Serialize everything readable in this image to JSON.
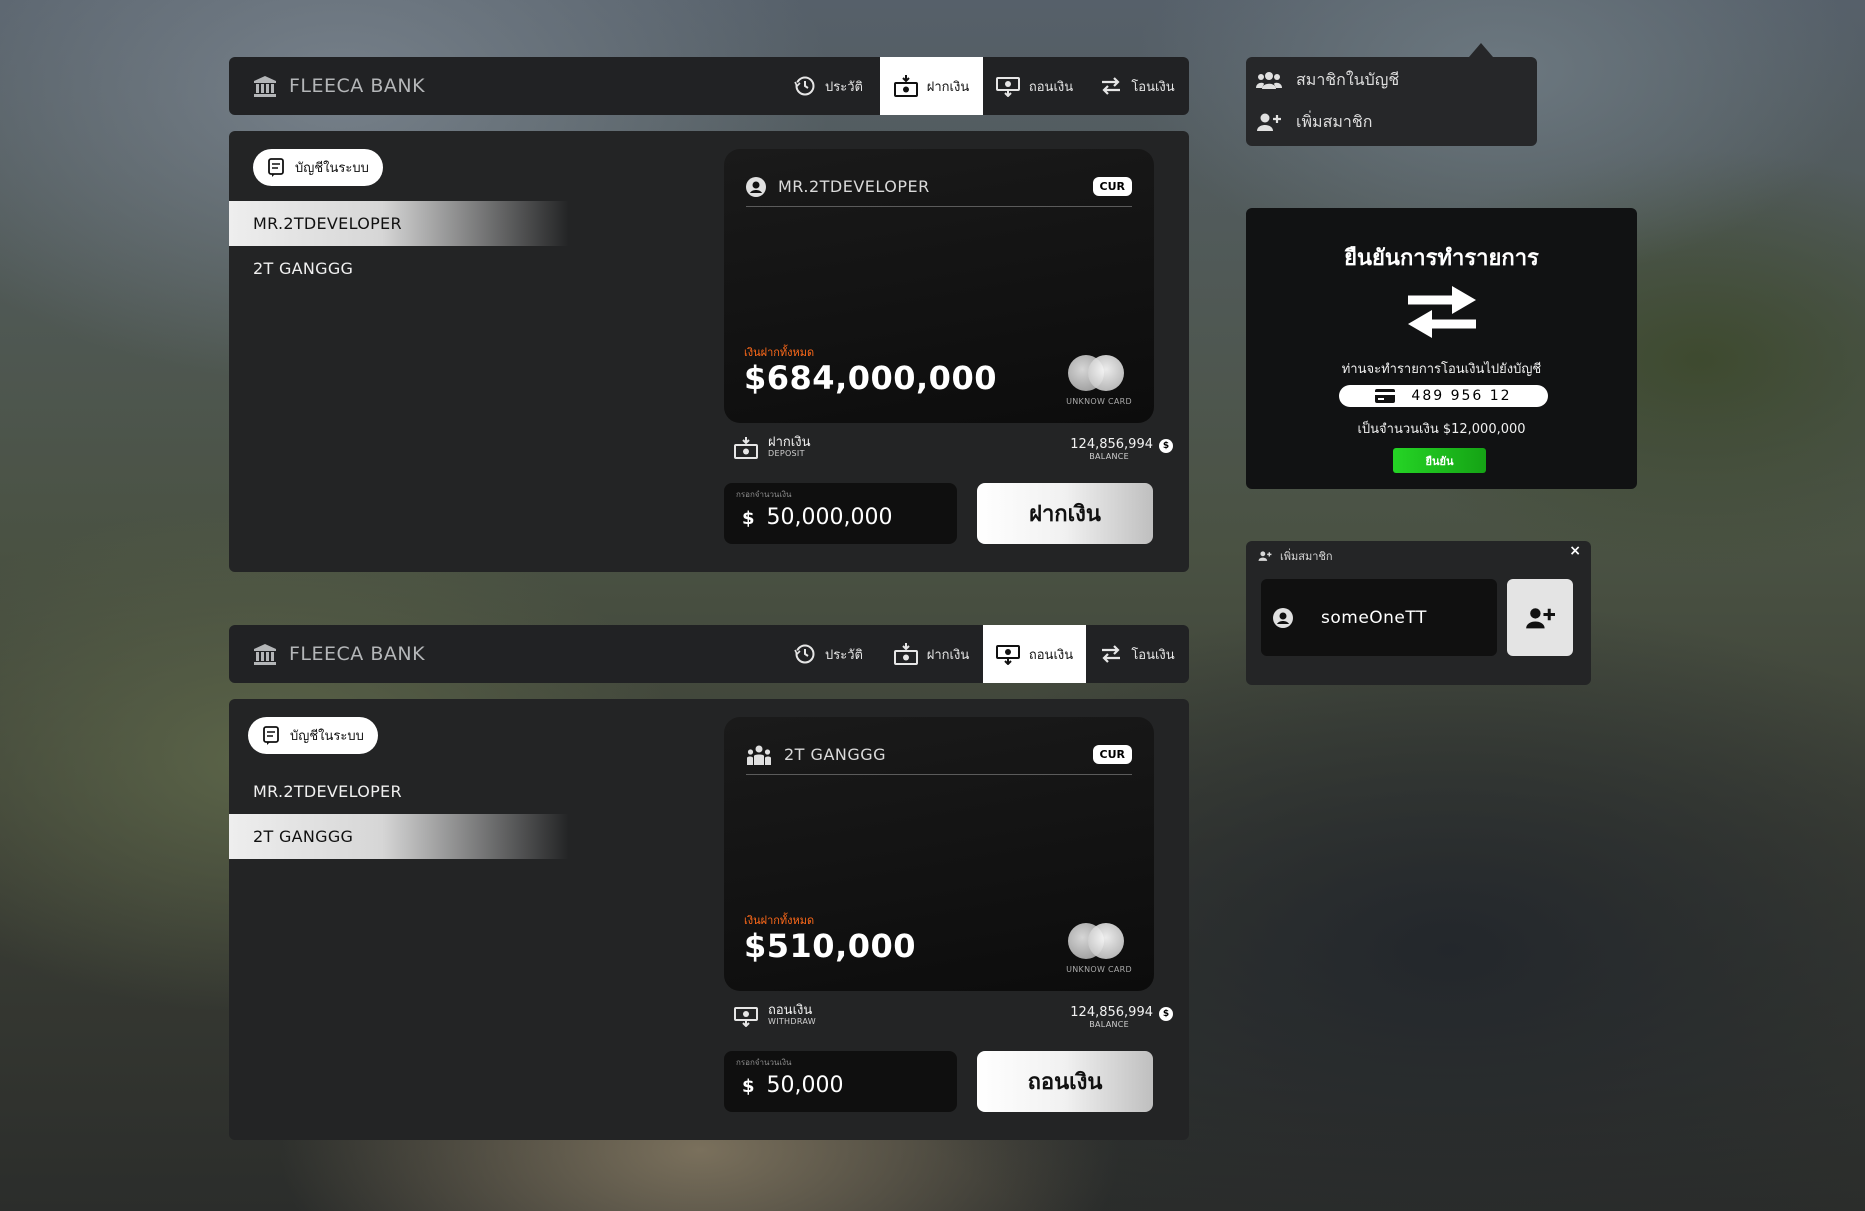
{
  "colors": {
    "panel_bg": "#232425",
    "nav_bg": "#212224",
    "accent_orange": "#ff6a1a",
    "confirm_green": "#1ecb1e"
  },
  "window1": {
    "brand": "FLEECA BANK",
    "tabs": [
      {
        "label": "ประวัติ",
        "icon": "history-icon"
      },
      {
        "label": "ฝากเงิน",
        "icon": "deposit-icon",
        "active": true
      },
      {
        "label": "ถอนเงิน",
        "icon": "withdraw-icon"
      },
      {
        "label": "โอนเงิน",
        "icon": "transfer-icon"
      }
    ],
    "accounts_button": "บัญชีในระบบ",
    "accounts": [
      "MR.2TDEVELOPER",
      "2T GANGGG"
    ],
    "selected_account": "MR.2TDEVELOPER",
    "card": {
      "owner": "MR.2TDEVELOPER",
      "currency": "CUR",
      "total_label": "เงินฝากทั้งหมด",
      "total": "$684,000,000",
      "card_type": "UNKNOW CARD"
    },
    "operation": {
      "title": "ฝากเงิน",
      "subtitle": "DEPOSIT"
    },
    "balance": {
      "value": "124,856,994",
      "label": "BALANCE",
      "symbol": "$"
    },
    "amount": {
      "placeholder": "กรอกจำนวนเงิน",
      "currency": "$",
      "value": "50,000,000"
    },
    "action_label": "ฝากเงิน"
  },
  "window2": {
    "brand": "FLEECA BANK",
    "tabs": [
      {
        "label": "ประวัติ",
        "icon": "history-icon"
      },
      {
        "label": "ฝากเงิน",
        "icon": "deposit-icon"
      },
      {
        "label": "ถอนเงิน",
        "icon": "withdraw-icon",
        "active": true
      },
      {
        "label": "โอนเงิน",
        "icon": "transfer-icon"
      }
    ],
    "accounts_button": "บัญชีในระบบ",
    "accounts": [
      "MR.2TDEVELOPER",
      "2T GANGGG"
    ],
    "selected_account": "2T GANGGG",
    "card": {
      "owner": "2T GANGGG",
      "currency": "CUR",
      "total_label": "เงินฝากทั้งหมด",
      "total": "$510,000",
      "card_type": "UNKNOW CARD"
    },
    "operation": {
      "title": "ถอนเงิน",
      "subtitle": "WITHDRAW"
    },
    "balance": {
      "value": "124,856,994",
      "label": "BALANCE",
      "symbol": "$"
    },
    "amount": {
      "placeholder": "กรอกจำนวนเงิน",
      "currency": "$",
      "value": "50,000"
    },
    "action_label": "ถอนเงิน"
  },
  "members_menu": {
    "items": [
      {
        "label": "สมาชิกในบัญชี",
        "icon": "users-icon"
      },
      {
        "label": "เพิ่มสมาชิก",
        "icon": "user-plus-icon"
      }
    ]
  },
  "confirm": {
    "title": "ยืนยันการทำรายการ",
    "icon": "transfer-arrows-icon",
    "message": "ท่านจะทำรายการโอนเงินไปยังบัญชี",
    "account_number": "489 956 12",
    "amount_text": "เป็นจำนวนเงิน $12,000,000",
    "button": "ยืนยัน"
  },
  "add_member": {
    "title": "เพิ่มสมาชิก",
    "close": "×",
    "input_value": "someOneTT"
  }
}
